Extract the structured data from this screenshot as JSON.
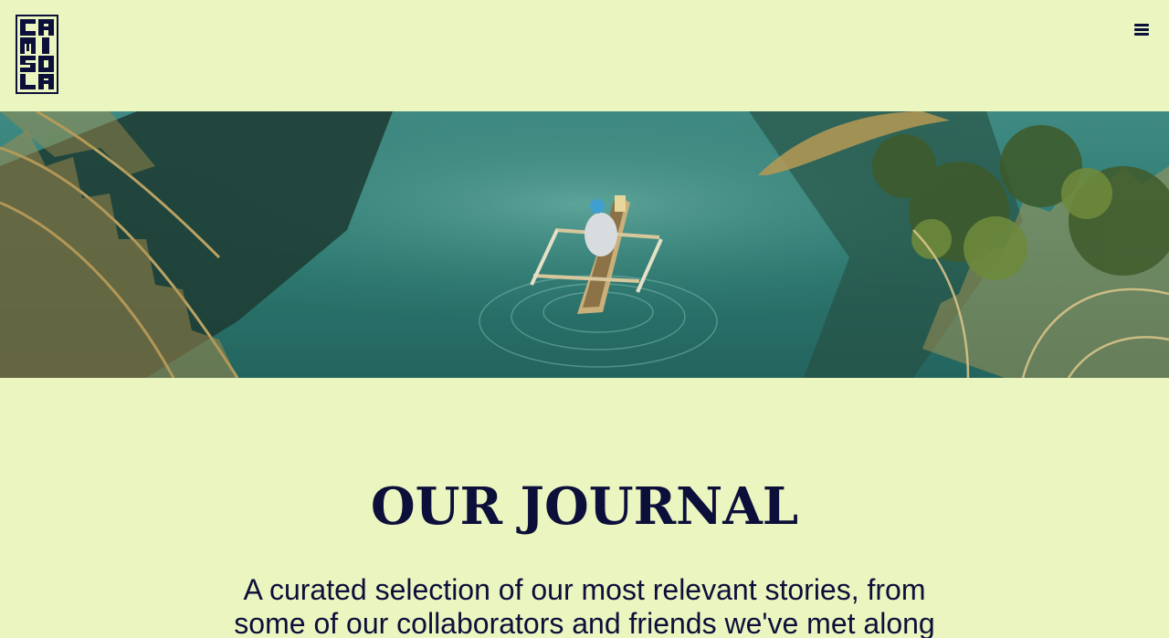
{
  "brand": {
    "logo_icon": "camisola-logo-icon",
    "logo_alt": "CAMISOLA",
    "colors": {
      "background": "#eaf5bf",
      "ink": "#0c0f3a"
    }
  },
  "header": {
    "menu_icon": "hamburger-menu-icon"
  },
  "hero": {
    "image": "river-canoe-palms-photo"
  },
  "main": {
    "title": "OUR JOURNAL",
    "subtitle": "A curated selection of our most relevant stories, from some of our collaborators and friends we've met along"
  }
}
